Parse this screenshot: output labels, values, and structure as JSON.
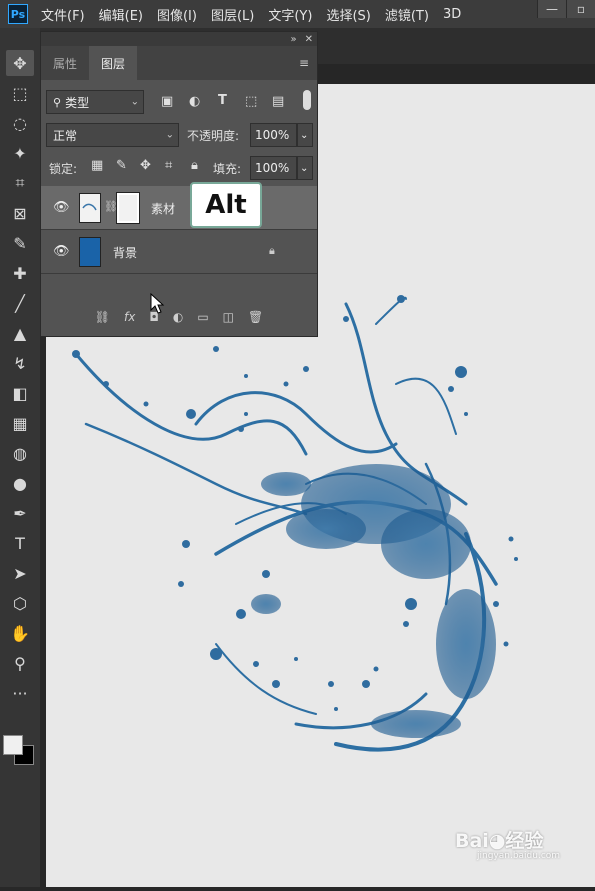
{
  "app": {
    "logo": "Ps"
  },
  "menu": [
    "文件(F)",
    "编辑(E)",
    "图像(I)",
    "图层(L)",
    "文字(Y)",
    "选择(S)",
    "滤镜(T)",
    "3D"
  ],
  "window_controls": {
    "minimize": "—",
    "maximize": "▫"
  },
  "tools": [
    "move-icon",
    "marquee-icon",
    "lasso-icon",
    "magic-wand-icon",
    "crop-icon",
    "frame-icon",
    "eyedropper-icon",
    "healing-icon",
    "brush-icon",
    "stamp-icon",
    "history-brush-icon",
    "eraser-icon",
    "gradient-icon",
    "blur-icon",
    "dodge-icon",
    "pen-icon",
    "type-icon",
    "path-select-icon",
    "shape-icon",
    "hand-icon",
    "zoom-icon",
    "more-icon"
  ],
  "tool_glyphs": [
    "✥",
    "⬚",
    "◌",
    "✦",
    "⌗",
    "⊠",
    "✎",
    "✚",
    "╱",
    "▲",
    "↯",
    "◧",
    "▦",
    "◍",
    "●",
    "✒",
    "T",
    "➤",
    "⬡",
    "✋",
    "⚲",
    "···"
  ],
  "colors": {
    "foreground": "#f0f0f0",
    "background": "#000000",
    "layer_thumb_bg": "#1a63a8",
    "accent": "#31a8ff"
  },
  "layers_panel": {
    "collapse_glyph": "»",
    "close_glyph": "✕",
    "tabs": [
      "属性",
      "图层"
    ],
    "active_tab": "图层",
    "menu_glyph": "≡",
    "filter": {
      "search_glyph": "⚲",
      "label": "类型"
    },
    "blend_mode": "正常",
    "opacity_label": "不透明度:",
    "opacity_value": "100%",
    "lock_label": "锁定:",
    "fill_label": "填充:",
    "fill_value": "100%",
    "layers": [
      {
        "name": "素材",
        "visible": true,
        "selected": true,
        "has_mask": true
      },
      {
        "name": "背景",
        "visible": true,
        "selected": false,
        "locked": true
      }
    ],
    "bottom_glyphs": [
      "⛓",
      "fx",
      "◘",
      "◐",
      "▭",
      "◫",
      "🗑"
    ]
  },
  "overlay": {
    "key_hint": "Alt"
  },
  "watermark": {
    "main": "Bai◕经验",
    "sub": "jingyan.baidu.com"
  }
}
